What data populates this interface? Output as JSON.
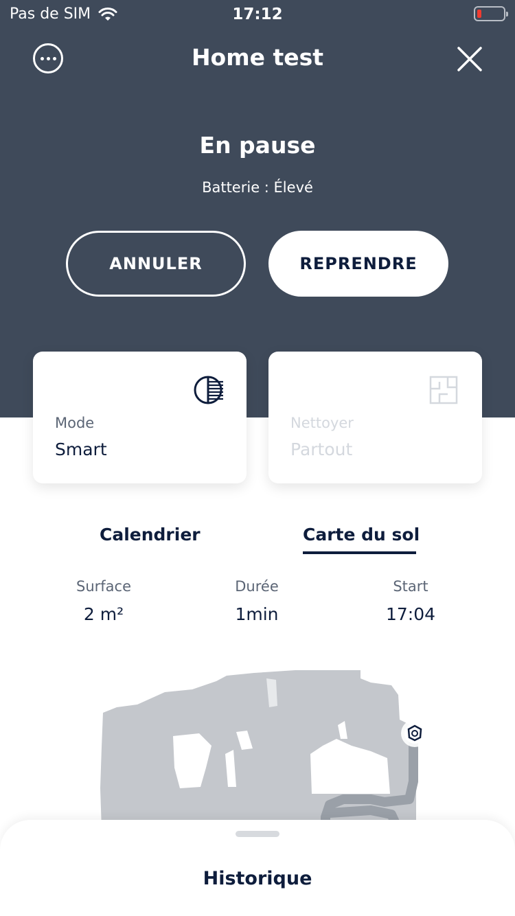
{
  "status_bar": {
    "carrier": "Pas de SIM",
    "time": "17:12",
    "wifi_icon": "wifi-icon",
    "battery_icon": "battery-low-icon"
  },
  "header": {
    "title": "Home test",
    "more_icon": "more-options-icon",
    "close_icon": "close-icon"
  },
  "status": {
    "title": "En pause",
    "battery_text": "Batterie : Élevé"
  },
  "actions": {
    "cancel_label": "ANNULER",
    "resume_label": "REPRENDRE"
  },
  "cards": {
    "mode": {
      "label": "Mode",
      "value": "Smart",
      "icon": "half-circle-icon"
    },
    "clean": {
      "label": "Nettoyer",
      "value": "Partout",
      "icon": "floor-plan-icon"
    }
  },
  "tabs": {
    "calendar": "Calendrier",
    "map": "Carte du sol"
  },
  "stats": {
    "surface": {
      "label": "Surface",
      "value": "2 m²"
    },
    "duration": {
      "label": "Durée",
      "value": "1min"
    },
    "start": {
      "label": "Start",
      "value": "17:04"
    }
  },
  "bottom_sheet": {
    "title": "Historique"
  },
  "colors": {
    "header_bg": "#3f4a5a",
    "text_dark": "#0e1d3c",
    "map_fill": "#c4c7cc",
    "map_path": "#9aa0a8",
    "battery_low": "#f03b30"
  }
}
